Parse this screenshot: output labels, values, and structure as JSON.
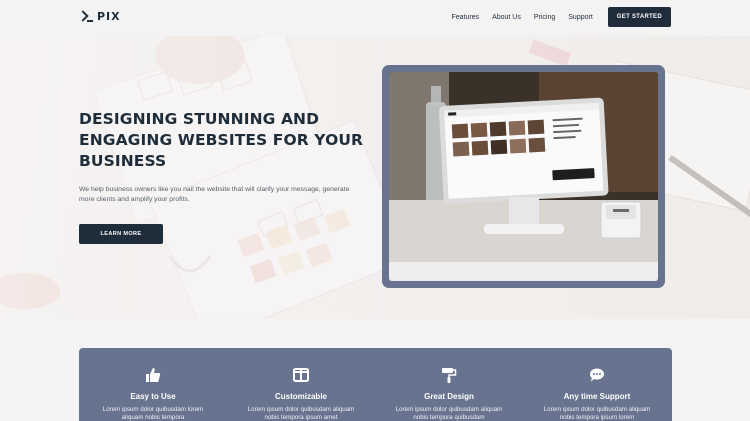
{
  "brand": {
    "name": "PIX",
    "logo_icon": "terminal-prompt-icon"
  },
  "nav": {
    "items": [
      "Features",
      "About Us",
      "Pricing",
      "Support"
    ],
    "cta_label": "GET STARTED"
  },
  "hero": {
    "title": "DESIGNING STUNNING AND ENGAGING WEBSITES FOR YOUR BUSINESS",
    "subtitle": "We help business owners like you nail the website that will clarify your message, generate more clients and amplify your profits.",
    "button_label": "LEARN MORE",
    "image_subject": "point-of-sale tablet terminal on counter"
  },
  "features": [
    {
      "title": "Easy to Use",
      "icon": "thumbs-up-icon",
      "text": "Lorem ipsum dolor quibusdam lorem aliquam nobis tempora"
    },
    {
      "title": "Customizable",
      "icon": "layout-columns-icon",
      "text": "Lorem ipsum dolor quibusdam aliquam nobis tempora ipsum amet"
    },
    {
      "title": "Great Design",
      "icon": "paint-roller-icon",
      "text": "Lorem ipsum dolor quibusdam aliquam nobis tempora quibusdam"
    },
    {
      "title": "Any time Support",
      "icon": "chat-bubble-icon",
      "text": "Lorem ipsum dolor quibusdam aliquam nobis tempora ipsum lorem"
    }
  ],
  "colors": {
    "primary": "#1f2d3a",
    "accent_panel": "#68738f",
    "page_bg": "#f4f3f4"
  }
}
